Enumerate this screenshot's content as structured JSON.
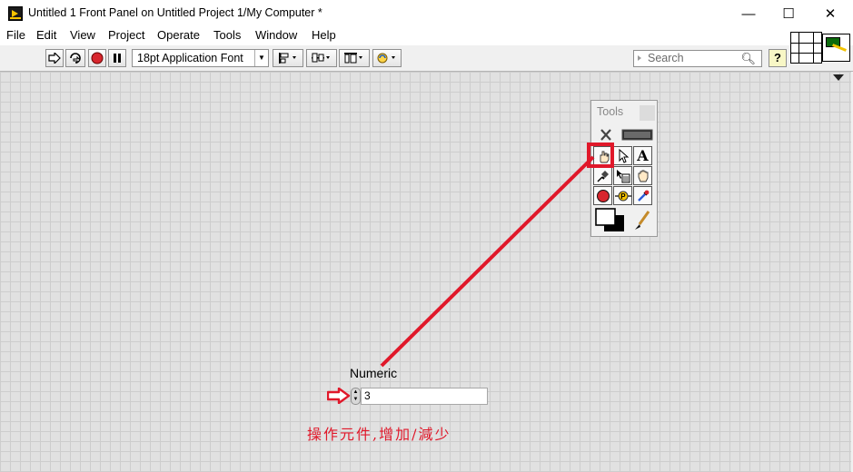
{
  "window": {
    "title": "Untitled 1 Front Panel on Untitled Project 1/My Computer *",
    "minimize": "—",
    "maximize": "☐",
    "close": "✕"
  },
  "menu": [
    "File",
    "Edit",
    "View",
    "Project",
    "Operate",
    "Tools",
    "Window",
    "Help"
  ],
  "toolbar": {
    "run_icon": "run-arrow-icon",
    "run_continuous_icon": "run-continuously-icon",
    "abort_icon": "abort-icon",
    "pause_icon": "pause-icon",
    "font": "18pt Application Font",
    "align_icon": "align-objects-icon",
    "distribute_icon": "distribute-objects-icon",
    "resize_icon": "resize-objects-icon",
    "reorder_icon": "reorder-icon",
    "search_placeholder": "Search",
    "help_label": "?"
  },
  "tools_palette": {
    "title": "Tools",
    "tools": [
      "automatic-tool-selection-icon",
      "operate-value-hand-icon",
      "position-arrow-icon",
      "edit-text-icon",
      "connect-wire-icon",
      "shortcut-menu-icon",
      "scroll-hand-icon",
      "breakpoint-icon",
      "probe-icon",
      "get-color-dropper-icon",
      "set-color-icon",
      "paint-brush-icon"
    ],
    "selected_tool": "operate-value-hand-icon"
  },
  "front_panel": {
    "numeric_label": "Numeric",
    "numeric_value": "3"
  },
  "annotation": {
    "text": "操作元件,增加/減少",
    "color": "#e0182a"
  }
}
